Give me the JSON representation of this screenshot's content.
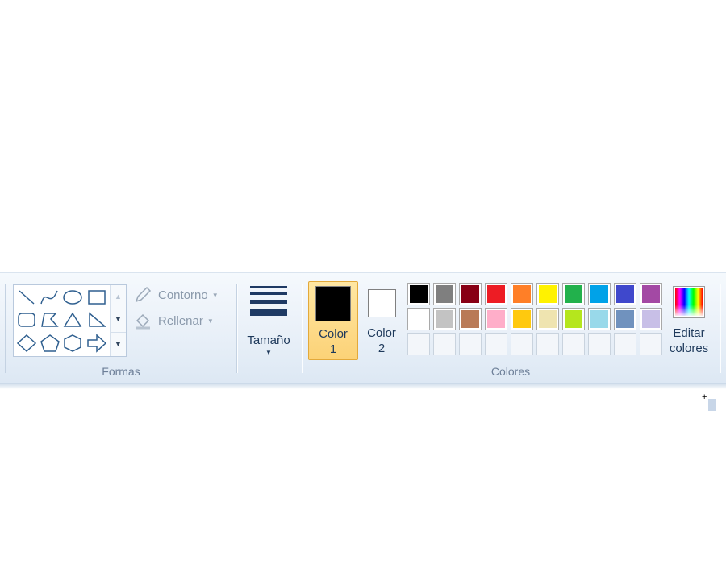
{
  "formas": {
    "group_label": "Formas",
    "shapes": [
      "line-icon",
      "curve-icon",
      "oval-icon",
      "rectangle-icon",
      "rounded-rectangle-icon",
      "polygon-icon",
      "triangle-icon",
      "right-triangle-icon",
      "diamond-icon",
      "pentagon-icon",
      "hexagon-icon",
      "right-arrow-icon"
    ],
    "contorno_label": "Contorno",
    "rellenar_label": "Rellenar"
  },
  "size": {
    "label": "Tamaño"
  },
  "colores": {
    "group_label": "Colores",
    "color1": {
      "label_line1": "Color",
      "label_line2": "1",
      "value": "#000000"
    },
    "color2": {
      "label_line1": "Color",
      "label_line2": "2",
      "value": "#ffffff"
    },
    "palette": [
      [
        "#000000",
        "#7f7f7f",
        "#880015",
        "#ed1c24",
        "#ff7f27",
        "#fff200",
        "#22b14c",
        "#00a2e8",
        "#3f48cc",
        "#a349a4"
      ],
      [
        "#ffffff",
        "#c3c3c3",
        "#b97a57",
        "#ffaec9",
        "#ffc90e",
        "#efe4b0",
        "#b5e61d",
        "#99d9ea",
        "#7092be",
        "#c8bfe7"
      ],
      [
        null,
        null,
        null,
        null,
        null,
        null,
        null,
        null,
        null,
        null
      ]
    ],
    "edit_label_line1": "Editar",
    "edit_label_line2": "colores"
  },
  "colors": {
    "ribbon_bg": "#e9f0f8",
    "accent_active": "#fcd277",
    "text": "#1e395b"
  }
}
